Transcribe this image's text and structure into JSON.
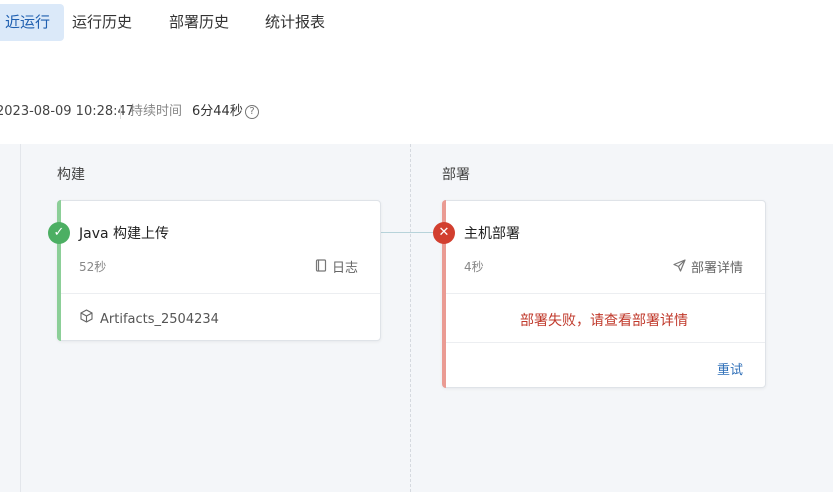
{
  "tabs": [
    {
      "label": "近运行",
      "active": true
    },
    {
      "label": "运行历史",
      "active": false
    },
    {
      "label": "部署历史",
      "active": false
    },
    {
      "label": "统计报表",
      "active": false
    }
  ],
  "info": {
    "start_time": "2023-08-09 10:28:47",
    "duration_label": "持续时间",
    "duration_value": "6分44秒"
  },
  "stages": [
    {
      "title": "构建",
      "job": {
        "status": "success",
        "title": "Java 构建上传",
        "elapsed": "52秒",
        "link_icon": "book-icon",
        "link_label": "日志",
        "artifact_icon": "cube-icon",
        "artifact": "Artifacts_2504234"
      }
    },
    {
      "title": "部署",
      "job": {
        "status": "failed",
        "title": "主机部署",
        "elapsed": "4秒",
        "link_icon": "send-icon",
        "link_label": "部署详情",
        "message": "部署失败，请查看部署详情",
        "action": "重试"
      }
    }
  ],
  "colors": {
    "success": "#4caf63",
    "failed": "#d23f2f",
    "link": "#2f6fb8",
    "active_tab_bg": "#dbe9f9"
  }
}
